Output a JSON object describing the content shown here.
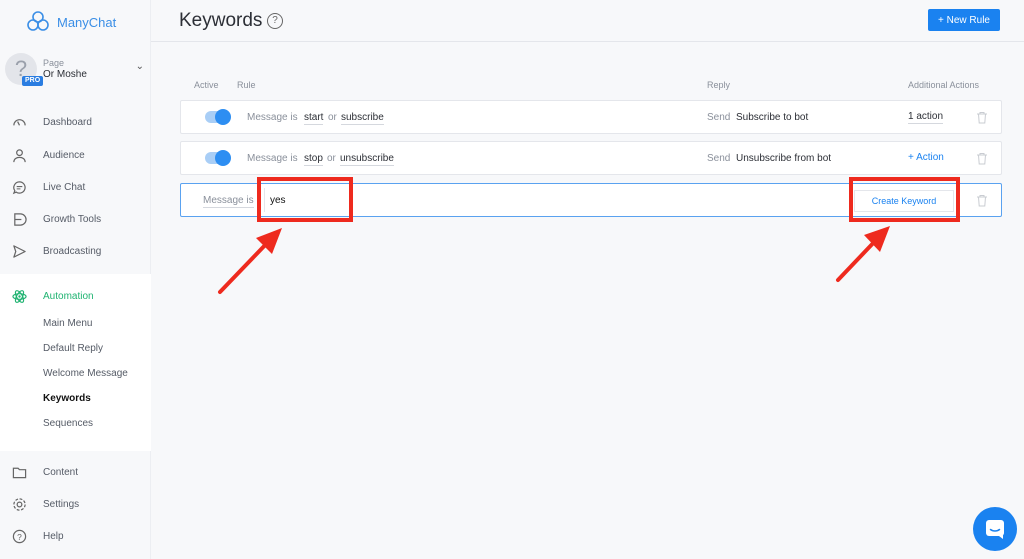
{
  "brand": {
    "name": "ManyChat"
  },
  "account": {
    "type": "Page",
    "name": "Or Moshe",
    "badge": "PRO"
  },
  "nav": {
    "dashboard": "Dashboard",
    "audience": "Audience",
    "live_chat": "Live Chat",
    "growth_tools": "Growth Tools",
    "broadcasting": "Broadcasting",
    "automation": "Automation",
    "content": "Content",
    "settings": "Settings",
    "help": "Help"
  },
  "automation_sub": {
    "main_menu": "Main Menu",
    "default_reply": "Default Reply",
    "welcome_message": "Welcome Message",
    "keywords": "Keywords",
    "sequences": "Sequences"
  },
  "header": {
    "title": "Keywords",
    "help": "?",
    "new_rule": "+ New Rule"
  },
  "columns": {
    "active": "Active",
    "rule": "Rule",
    "reply": "Reply",
    "additional_actions": "Additional Actions"
  },
  "rules": [
    {
      "active": true,
      "condition": "Message is",
      "kw1": "start",
      "or": "or",
      "kw2": "subscribe",
      "send": "Send",
      "reply": "Subscribe to bot",
      "action": "1 action"
    },
    {
      "active": true,
      "condition": "Message is",
      "kw1": "stop",
      "or": "or",
      "kw2": "unsubscribe",
      "send": "Send",
      "reply": "Unsubscribe from bot",
      "action": "+ Action"
    }
  ],
  "new_rule_row": {
    "condition": "Message is",
    "value": "yes",
    "button": "Create Keyword"
  },
  "colors": {
    "accent": "#1a82f0",
    "active_green": "#1fb371",
    "highlight_red": "#ee2a1e"
  }
}
